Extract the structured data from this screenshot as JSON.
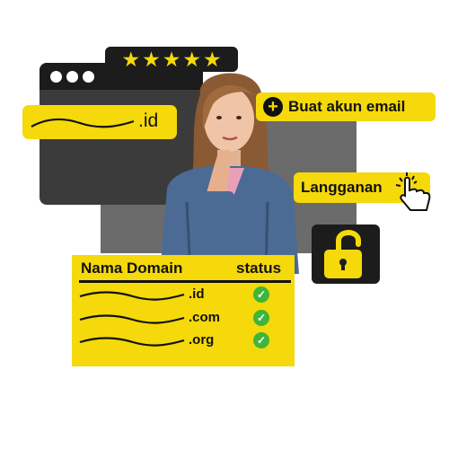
{
  "rating": {
    "stars": 5
  },
  "browser_mock": {
    "url_extension": ".id"
  },
  "actions": {
    "create_email_label": "Buat akun email",
    "subscribe_label": "Langganan"
  },
  "domain_table": {
    "header_name": "Nama Domain",
    "header_status": "status",
    "rows": [
      {
        "extension": ".id",
        "status": "check"
      },
      {
        "extension": ".com",
        "status": "check"
      },
      {
        "extension": ".org",
        "status": "check"
      }
    ]
  },
  "colors": {
    "accent": "#f5d90a",
    "dark": "#1c1c1c",
    "success": "#3fb53a"
  }
}
